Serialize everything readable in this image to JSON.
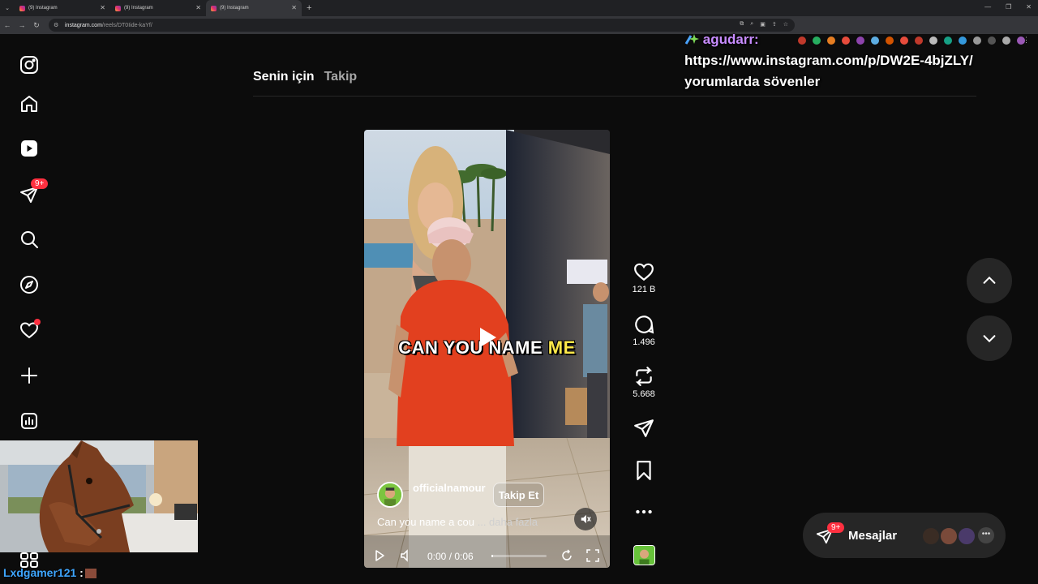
{
  "browser": {
    "tabs": [
      {
        "title": "(9) Instagram"
      },
      {
        "title": "(9) Instagram"
      },
      {
        "title": "(9) Instagram"
      }
    ],
    "active_tab_index": 2,
    "url_host": "instagram.com",
    "url_path": "/reels/DT0Iide-kaYf/",
    "new_tab_symbol": "+"
  },
  "sidebar": {
    "items": [
      {
        "name": "instagram-logo-icon"
      },
      {
        "name": "home-icon"
      },
      {
        "name": "reels-icon"
      },
      {
        "name": "messages-icon",
        "badge": "9+"
      },
      {
        "name": "search-icon"
      },
      {
        "name": "explore-icon"
      },
      {
        "name": "notifications-icon"
      },
      {
        "name": "create-icon"
      },
      {
        "name": "dashboard-icon"
      },
      {
        "name": "more-icon"
      }
    ]
  },
  "feed_tabs": {
    "for_you": "Senin için",
    "following": "Takip"
  },
  "overlay_comment": {
    "user": "agudarr:",
    "line1": "https://www.instagram.com/p/DW2E-4bjZLY/",
    "line2": "yorumlarda sövenler"
  },
  "reel": {
    "caption_overlay_part1": "CAN YOU NAME ",
    "caption_overlay_part2": "ME",
    "author": "officialnamour",
    "follow_label": "Takip Et",
    "description": "Can you name a cou",
    "more_label": "... daha fazla",
    "time_current": "0:00",
    "time_sep": " / ",
    "time_total": "0:06",
    "progress": 0.0
  },
  "actions": {
    "likes": "121 B",
    "comments": "1.496",
    "reposts": "5.668"
  },
  "messages": {
    "label": "Mesajlar",
    "badge": "9+"
  },
  "chat": {
    "user": "Lxdgamer121",
    "colon": " :"
  },
  "colors": {
    "accent_red": "#ff3040",
    "bg": "#0c0c0c",
    "overlay_user": "#c88cff",
    "caption_highlight": "#ffe94a"
  }
}
